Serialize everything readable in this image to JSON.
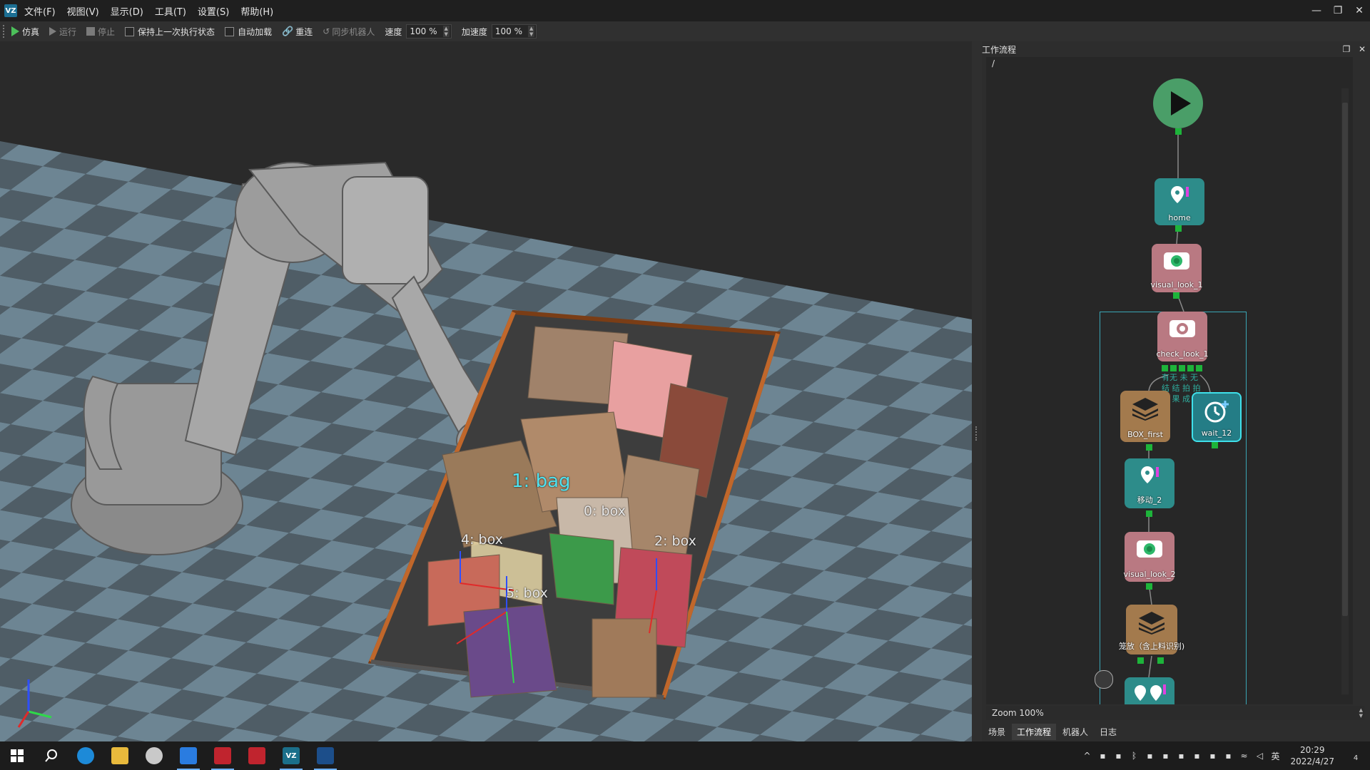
{
  "app": {
    "logo_text": "VZ"
  },
  "menu": {
    "items": [
      "文件(F)",
      "视图(V)",
      "显示(D)",
      "工具(T)",
      "设置(S)",
      "帮助(H)"
    ]
  },
  "window_controls": {
    "minimize": "—",
    "restore": "❐",
    "close": "✕"
  },
  "toolbar": {
    "simulate": "仿真",
    "run": "运行",
    "stop": "停止",
    "keep_state": "保持上一次执行状态",
    "auto_load": "自动加载",
    "reconnect": "重连",
    "sync_robot": "同步机器人",
    "speed_label": "速度",
    "speed_value": "100 %",
    "accel_label": "加速度",
    "accel_value": "100 %"
  },
  "viewport": {
    "detections": [
      {
        "label": "1: bag"
      },
      {
        "label": "0: box"
      },
      {
        "label": "4: box"
      },
      {
        "label": "2: box"
      },
      {
        "label": "5: box"
      }
    ]
  },
  "workflow_panel": {
    "title": "工作流程",
    "path": "/",
    "nodes": {
      "home": "home",
      "visual_look_1": "visual_look_1",
      "check_look_1": "check_look_1",
      "box_first": "BOX_first",
      "wait_12": "wait_12",
      "move_2": "移动_2",
      "visual_look_2": "visual_look_2",
      "place": "笼放（含上料识别)"
    },
    "hint_lines": [
      "有无 未 无",
      "结 结 拍 拍",
      "果 果 成"
    ],
    "zoom": "Zoom 100%",
    "tabs": [
      "场景",
      "工作流程",
      "机器人",
      "日志"
    ],
    "active_tab": "工作流程"
  },
  "taskbar": {
    "apps": [
      {
        "icon": "windows-start-icon"
      },
      {
        "icon": "search-icon"
      },
      {
        "icon": "edge-browser-icon"
      },
      {
        "icon": "file-explorer-icon"
      },
      {
        "icon": "app-icon"
      },
      {
        "icon": "app-icon"
      },
      {
        "icon": "app-icon"
      },
      {
        "icon": "app-icon"
      },
      {
        "icon": "vz-app-icon"
      },
      {
        "icon": "vision-app-icon"
      }
    ],
    "ime": "英",
    "time": "20:29",
    "date": "2022/4/27",
    "notification_count": "4"
  }
}
